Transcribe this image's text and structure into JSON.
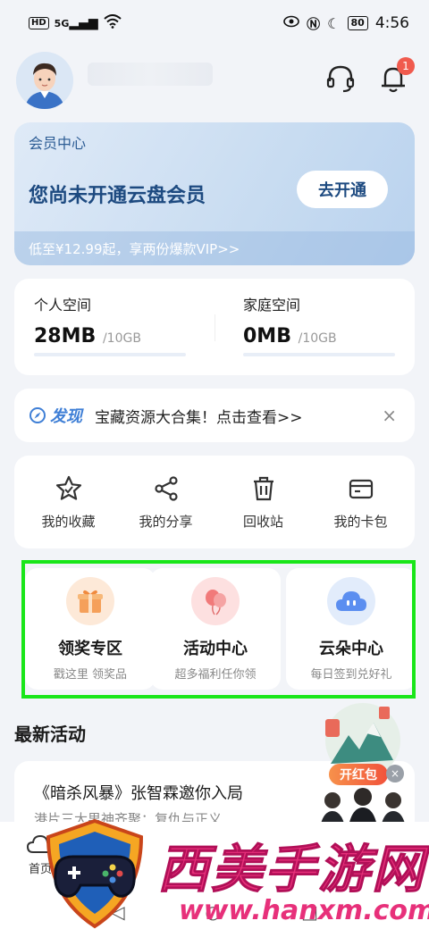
{
  "status": {
    "time": "4:56",
    "hd": "HD",
    "signal": "5G",
    "battery": "80"
  },
  "header": {
    "avatar_icon": "user-avatar",
    "support_icon": "headset-icon",
    "notify_icon": "bell-icon",
    "notify_count": "1"
  },
  "vip": {
    "title": "会员中心",
    "message": "您尚未开通云盘会员",
    "button": "去开通",
    "promo": "低至¥12.99起，享两份爆款VIP>>"
  },
  "storage": {
    "personal": {
      "label": "个人空间",
      "used": "28MB",
      "total": "/10GB"
    },
    "family": {
      "label": "家庭空间",
      "used": "0MB",
      "total": "/10GB"
    }
  },
  "discover": {
    "tag": "发现",
    "text": "宝藏资源大合集！点击查看>>",
    "close": "×"
  },
  "tools": [
    {
      "label": "我的收藏",
      "icon": "star-icon"
    },
    {
      "label": "我的分享",
      "icon": "share-icon"
    },
    {
      "label": "回收站",
      "icon": "trash-icon"
    },
    {
      "label": "我的卡包",
      "icon": "card-wallet-icon"
    }
  ],
  "promos": [
    {
      "title": "领奖专区",
      "sub": "戳这里 领奖品",
      "icon": "gift-icon",
      "color": "#fde9d8"
    },
    {
      "title": "活动中心",
      "sub": "超多福利任你领",
      "icon": "balloon-icon",
      "color": "#fde0e0"
    },
    {
      "title": "云朵中心",
      "sub": "每日签到兑好礼",
      "icon": "cloud-icon",
      "color": "#e2ecfb"
    }
  ],
  "latest": {
    "title": "最新活动",
    "activity_title": "《暗杀风暴》张智霖邀你入局",
    "activity_sub": "港片三大男神齐聚：复仇与正义"
  },
  "float": {
    "button": "开红包",
    "close": "×"
  },
  "nav": {
    "home": "首页"
  },
  "watermark": {
    "title": "西美手游网",
    "url": "www.hanxm.com"
  },
  "colors": {
    "accent": "#3f7fd6",
    "highlight": "#19e619",
    "vip_text": "#1d4a80",
    "watermark": "#e7307a"
  }
}
